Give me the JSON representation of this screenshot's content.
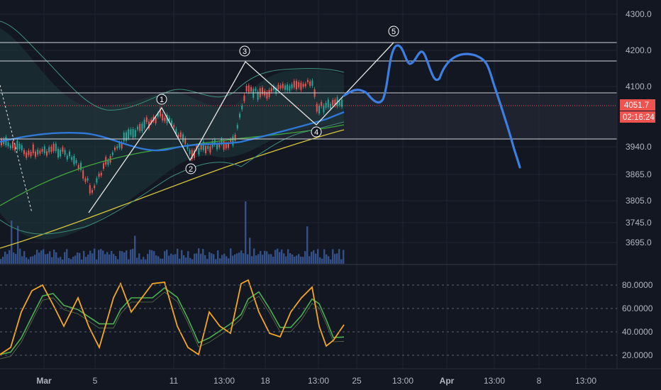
{
  "chart_data": {
    "type": "line",
    "price_axis": {
      "ticks": [
        "4300.0",
        "4200.0",
        "4100.0",
        "3940.0",
        "3865.0",
        "3805.0",
        "3745.0",
        "3695.0"
      ]
    },
    "oscillator_axis": {
      "ticks": [
        "80.0000",
        "60.0000",
        "40.0000",
        "20.0000"
      ]
    },
    "time_axis": {
      "labels": [
        "Mar",
        "5",
        "11",
        "13:00",
        "18",
        "13:00",
        "25",
        "13:00",
        "Apr",
        "13:00",
        "8",
        "13:00"
      ]
    },
    "last_price": "4051.7",
    "countdown": "02:16:24",
    "wave_labels": [
      "1",
      "2",
      "3",
      "4",
      "5"
    ],
    "horizontal_levels": [
      4224,
      4172,
      4080,
      3960
    ],
    "projection_path_description_none": null,
    "colors": {
      "background": "#131722",
      "projection": "#3d7ee0",
      "price_tag": "#ef5350",
      "ema_blue": "#2f78d8",
      "sma_green": "#3fa63f",
      "sma_yellow": "#d8c53a",
      "stoch_k": "#f5a623",
      "stoch_d": "#4caf50",
      "volume": "#3a5a9a",
      "wave_lines": "#e6e6e6"
    }
  }
}
